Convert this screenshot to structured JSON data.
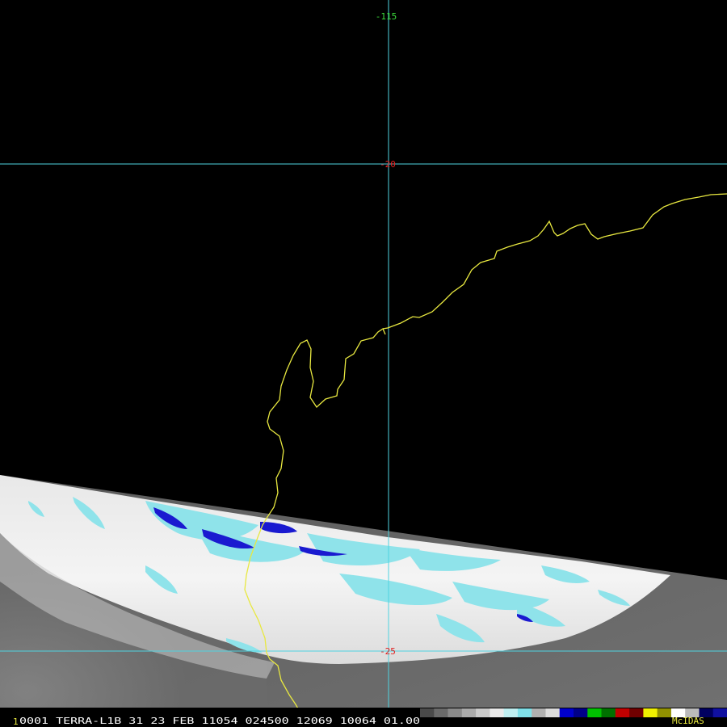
{
  "grid": {
    "lon_label": "-115",
    "lat_labels": [
      "-20",
      "-25"
    ],
    "line_color": "#4fd3e0",
    "lon_label_color": "#3cdc3c",
    "lat_label_color": "#e02020"
  },
  "coastline_color": "#e8e840",
  "status_bar": {
    "frame_marker": "1",
    "text": "0001 TERRA-L1B 31 23 FEB 11054 024500 12069 10064 01.00",
    "brand": "McIDAS",
    "text_color": "#ffffff",
    "brand_color": "#e8e840"
  },
  "color_bar": {
    "segments": [
      "#4a4a4a",
      "#6a6a6a",
      "#8a8a8a",
      "#aaaaaa",
      "#cacaca",
      "#eaeaea",
      "#bfeef0",
      "#7fe0e8",
      "#b0b0b0",
      "#dcdcdc",
      "#0000cc",
      "#000088",
      "#00c000",
      "#007000",
      "#c00000",
      "#700000",
      "#f0f000",
      "#909000",
      "#ffffff",
      "#bbbbbb",
      "#000060",
      "#1010a0"
    ]
  }
}
